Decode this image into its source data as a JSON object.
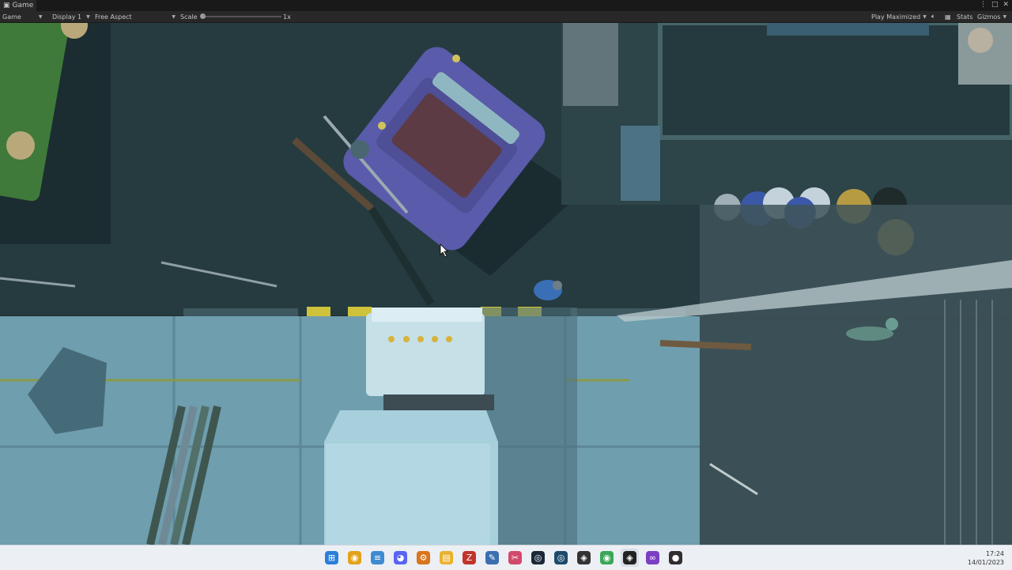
{
  "tab": {
    "icon": "gamepad-icon",
    "label": "Game"
  },
  "window_controls": [
    "menu-dots-icon",
    "maximize-icon",
    "close-icon"
  ],
  "toolbar": {
    "mode": "Game",
    "display": "Display 1",
    "aspect": "Free Aspect",
    "scale_label": "Scale",
    "scale_value": "1x",
    "play_mode": "Play Maximized",
    "mute_icon": "speaker-icon",
    "stats_icon": "grid-icon",
    "stats": "Stats",
    "gizmos": "Gizmos"
  },
  "taskbar": {
    "icons": [
      "windows-start-icon",
      "chrome-icon",
      "notepad-icon",
      "discord-icon",
      "settings-gear-icon",
      "file-explorer-icon",
      "filezilla-icon",
      "paint-icon",
      "snipping-tool-icon",
      "steam-icon",
      "steam-alt-icon",
      "unity-hub-icon",
      "chrome-badge-icon",
      "unity-icon",
      "visual-studio-icon",
      "obs-icon"
    ],
    "active_index": 13,
    "time": "17:24",
    "date": "14/01/2023"
  }
}
